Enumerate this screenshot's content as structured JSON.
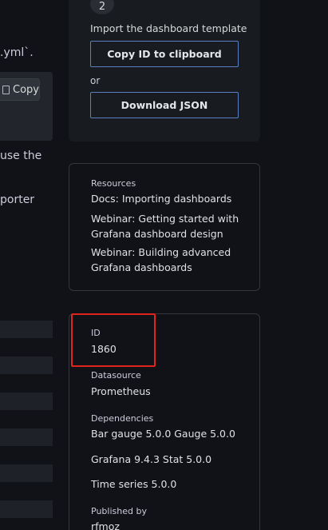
{
  "left": {
    "text_1": ".yml`.",
    "copy_label": "Copy",
    "text_2": "use the",
    "text_3": "porter"
  },
  "import": {
    "step_number": "2",
    "title": "Import the dashboard template",
    "copy_id_label": "Copy ID to clipboard",
    "or_label": "or",
    "download_label": "Download JSON"
  },
  "resources": {
    "heading": "Resources",
    "links": [
      "Docs: Importing dashboards",
      "Webinar: Getting started with Grafana dashboard design",
      "Webinar: Building advanced Grafana dashboards"
    ]
  },
  "meta": {
    "id_label": "ID",
    "id_value": "1860",
    "datasource_label": "Datasource",
    "datasource_value": "Prometheus",
    "dependencies_label": "Dependencies",
    "dependencies": [
      "Bar gauge 5.0.0 Gauge 5.0.0",
      "Grafana 9.4.3 Stat 5.0.0",
      "Time series 5.0.0"
    ],
    "published_label": "Published by",
    "published_value": "rfmoz"
  },
  "colors": {
    "background": "#111217",
    "card_background": "#181b1f",
    "button_border": "#5b7fc2",
    "highlight": "#e0241b"
  }
}
